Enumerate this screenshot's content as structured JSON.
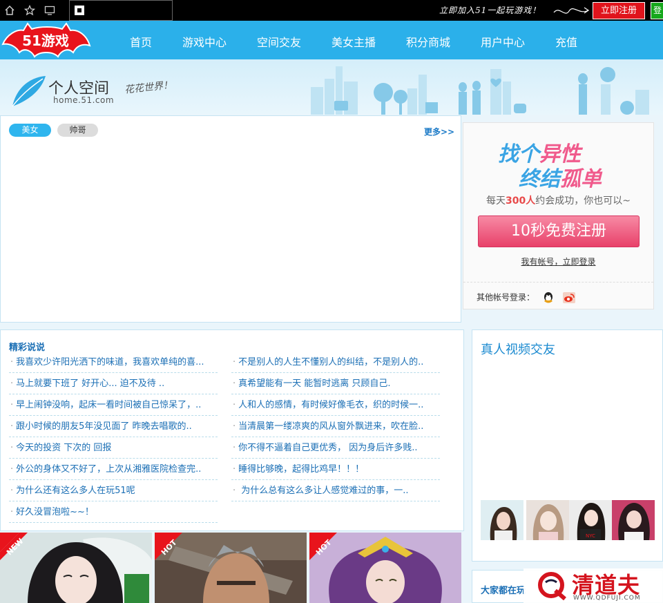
{
  "topbar": {
    "slogan": "立即加入51一起玩游戏！",
    "register_btn": "立即注册",
    "green_btn": "登"
  },
  "nav": {
    "logo_text": "51游戏",
    "items": [
      "首页",
      "游戏中心",
      "空间交友",
      "美女主播",
      "积分商城",
      "用户中心",
      "充值"
    ]
  },
  "banner": {
    "title": "个人空间",
    "domain": "home.51.com",
    "tagline": "花花世界！"
  },
  "tabs": {
    "active": "美女",
    "idle": "帅哥",
    "more": "更多>>"
  },
  "register": {
    "line1_blue": "找个",
    "line1_pink": "异性",
    "line2_blue": "终结",
    "line2_pink": "孤单",
    "daily_prefix": "每天",
    "daily_count": "300人",
    "daily_suffix": "约会成功，你也可以~",
    "free_btn": "10秒免费注册",
    "login_link": "我有帐号，立即登录",
    "other_login": "其他帐号登录："
  },
  "posts": {
    "title": "精彩说说",
    "left": [
      "我喜欢少许阳光洒下的味道，我喜欢单纯的喜...",
      "马上就要下班了 好开心... 迫不及待 ..",
      "早上闹钟没响，起床一看时间被自己惊呆了，..",
      "跟小时候的朋友5年没见面了 昨晚去唱歌的..",
      "今天的投资  下次的 回报",
      "外公的身体又不好了，上次从湘雅医院检查完..",
      "为什么还有这么多人在玩51呢",
      "好久没冒泡啦~~！"
    ],
    "right": [
      "不是别人的人生不懂别人的纠结，不是别人的..",
      "真希望能有一天 能暂时逃离 只顾自己.",
      "人和人的感情，有时候好像毛衣，织的时候一..",
      "当清晨第一缕凉爽的风从窗外飘进来，吹在脸..",
      "你不得不逼着自己更优秀， 因为身后许多贱..",
      "睡得比够晚，起得比鸡早！！！",
      " 为什么总有这么多让人感觉难过的事，一..",
      ""
    ]
  },
  "video": {
    "title": "真人视频交友"
  },
  "everyone": {
    "title": "大家都在玩"
  },
  "tiles": {
    "badges": [
      "NEW",
      "HOT",
      "HOT"
    ]
  },
  "watermark": {
    "text": "清道夫",
    "url": "WWW.QDFUJI.COM"
  }
}
